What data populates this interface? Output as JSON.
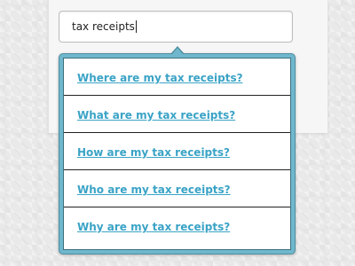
{
  "search": {
    "value": "tax receipts"
  },
  "results": [
    {
      "label": "Where are my tax receipts?"
    },
    {
      "label": "What are my tax receipts?"
    },
    {
      "label": "How are my tax receipts?"
    },
    {
      "label": "Who are my tax receipts?"
    },
    {
      "label": "Why are my tax receipts?"
    }
  ],
  "colors": {
    "dropdown_border": "#6fb7cc",
    "link": "#3aa3c6",
    "background": "#e9e9e9"
  }
}
